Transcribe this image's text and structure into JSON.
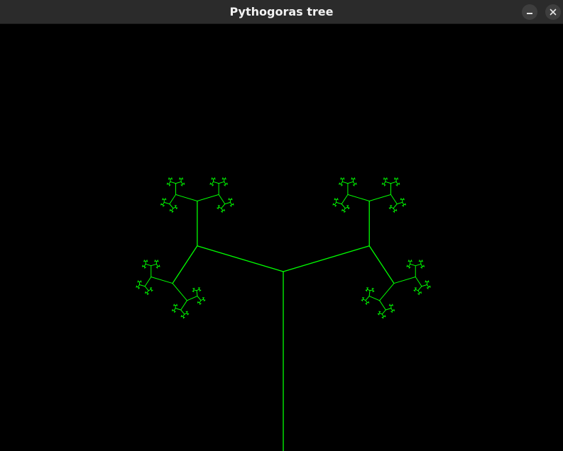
{
  "window": {
    "title": "Pythogoras tree"
  },
  "icons": {
    "minimize": "minimize-icon",
    "close": "close-icon"
  },
  "colors": {
    "background": "#000000",
    "branch": "#00ff00",
    "titlebar": "#2b2b2b",
    "title_text": "#f2f2f2"
  }
}
